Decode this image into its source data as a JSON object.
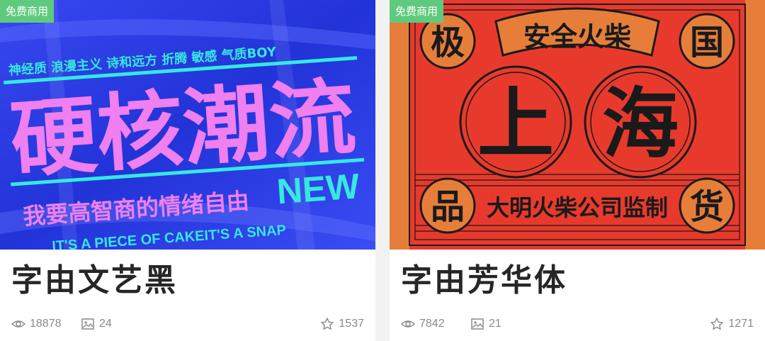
{
  "cards": [
    {
      "badge": "免费商用",
      "font_name": "字由文艺黑",
      "views": "18878",
      "images": "24",
      "favorites": "1537",
      "preview": {
        "line1": "神经质 浪漫主义 诗和远方 折腾 敏感 气质BOY",
        "headline": "硬核潮流",
        "line3": "我要高智商的情绪自由",
        "new_label": "NEW",
        "line4": "IT'S A PIECE OF CAKEIT'S A SNAP"
      }
    },
    {
      "badge": "免费商用",
      "font_name": "字由芳华体",
      "views": "7842",
      "images": "21",
      "favorites": "1271",
      "preview": {
        "banner": "安全火柴",
        "corner_tl": "极",
        "corner_tr": "国",
        "corner_bl": "品",
        "corner_br": "货",
        "big_left": "上",
        "big_right": "海",
        "maker": "大明火柴公司监制"
      }
    }
  ],
  "colors": {
    "badge": "#5fca7d",
    "card_a_bg": "#2f3fe6",
    "card_a_pink": "#f07ff0",
    "card_a_cyan": "#35e8e0",
    "card_b_red": "#e83a2c",
    "card_b_orange": "#e67e3a",
    "ink": "#1a1a1a"
  }
}
